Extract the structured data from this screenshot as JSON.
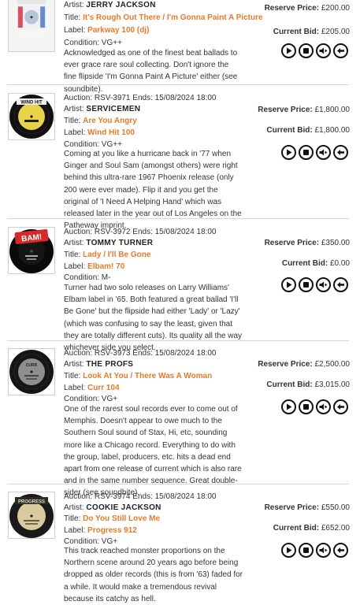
{
  "lots": [
    {
      "auction_line": "",
      "artist_label": "Artist:",
      "artist": "JERRY JACKSON",
      "title_label": "Title:",
      "title": "It's Rough Out There / I'm Gonna Paint A Picture",
      "label_label": "Label:",
      "label": "Parkway 100 (dj)",
      "condition": "Condition: VG++",
      "description": "Acknowledged as one of the finest beat ballads to ever grace rare soul collecting. Don't ignore the fine flipside 'I'm Gonna Paint A Picture' either (see soundbite).",
      "reserve_label": "Reserve Price:",
      "reserve": "£200.00",
      "bid_label": "Current Bid:",
      "bid": "£205.00",
      "record_text": "",
      "colors": {
        "disc": "#f4f4f2",
        "center": "#b8c4d8",
        "ring": "#d85060"
      }
    },
    {
      "auction_line": "Auction: RSV-3971  Ends: 15/08/2024 18:00",
      "artist_label": "Artist:",
      "artist": "SERVICEMEN",
      "title_label": "Title:",
      "title": "Are You Angry",
      "label_label": "Label:",
      "label": "Wind Hit 100",
      "condition": "Condition: VG++",
      "description": "Coming at you like a hurricane back in '77 when Ginger and Soul Sam (amongst others) were right behind this ultra-rare 1967 Phoenix release (only 200 were ever made). Flip it and you get the original of 'I Need A Helping Hand' which was released later in the year out of Los Angeles on the Patheway imprint.",
      "reserve_label": "Reserve Price:",
      "reserve": "£1,800.00",
      "bid_label": "Current Bid:",
      "bid": "£1,800.00",
      "record_text": "WIND HIT",
      "colors": {
        "disc": "#111111",
        "center": "#e8d24a",
        "ring": "#c8b030"
      }
    },
    {
      "auction_line": "Auction: RSV-3972  Ends: 15/08/2024 18:00",
      "artist_label": "Artist:",
      "artist": "TOMMY TURNER",
      "title_label": "Title:",
      "title": "Lady / I'll Be Gone",
      "label_label": "Label:",
      "label": "Elbam! 70",
      "condition": "Condition: M-",
      "description": "Turner had two solo releases on Larry Williams' Elbam label in '65. Both featured a great ballad 'I'll Be Gone' but the flipside had either 'Lady' or 'Lazy' (which was confusing to say the least, given that they are totally different cuts). Its quality all the way whichever side you select.",
      "reserve_label": "Reserve Price:",
      "reserve": "£350.00",
      "bid_label": "Current Bid:",
      "bid": "£0.00",
      "record_text": "BAM!",
      "colors": {
        "disc": "#0a0a0a",
        "center": "#161616",
        "ring": "#d42a2a"
      }
    },
    {
      "auction_line": "Auction: RSV-3973  Ends: 15/08/2024 18:00",
      "artist_label": "Artist:",
      "artist": "THE PROFS",
      "title_label": "Title:",
      "title": "Look At You / There Was A Woman",
      "label_label": "Label:",
      "label": "Curr 104",
      "condition": "Condition: VG+",
      "description": "One of the rarest soul records ever to come out of Memphis. Doesn't appear to owe much to the Southern Soul sound of Stax, Hi, etc, sounding more like a Chicago record. Everything to do with the group, label, producers, etc. hits a dead end apart from one release of current which is also rare and in the same number sequence. Great double-sider (see soundbite).",
      "reserve_label": "Reserve Price:",
      "reserve": "£2,500.00",
      "bid_label": "Current Bid:",
      "bid": "£3,015.00",
      "record_text": "CURR",
      "colors": {
        "disc": "#151515",
        "center": "#8e8e8e",
        "ring": "#6a6a6a"
      }
    },
    {
      "auction_line": "Auction: RSV-3974  Ends: 15/08/2024 18:00",
      "artist_label": "Artist:",
      "artist": "COOKIE JACKSON",
      "title_label": "Title:",
      "title": "Do You Still Love Me",
      "label_label": "Label:",
      "label": "Progress 912",
      "condition": "Condition: VG+",
      "description": "This track reached monster proportions on the Northern scene around 20 years ago before being dropped as older records (this is from '63) faded for a while. It would make a tremendous revival because its catchy as hell.",
      "reserve_label": "Reserve Price:",
      "reserve": "£550.00",
      "bid_label": "Current Bid:",
      "bid": "£652.00",
      "record_text": "PROGRESS",
      "colors": {
        "disc": "#1a1a1a",
        "center": "#d8c9a0",
        "ring": "#b8a878"
      }
    }
  ],
  "controls": [
    "play-icon",
    "stop-icon",
    "volume-icon",
    "back-icon"
  ]
}
